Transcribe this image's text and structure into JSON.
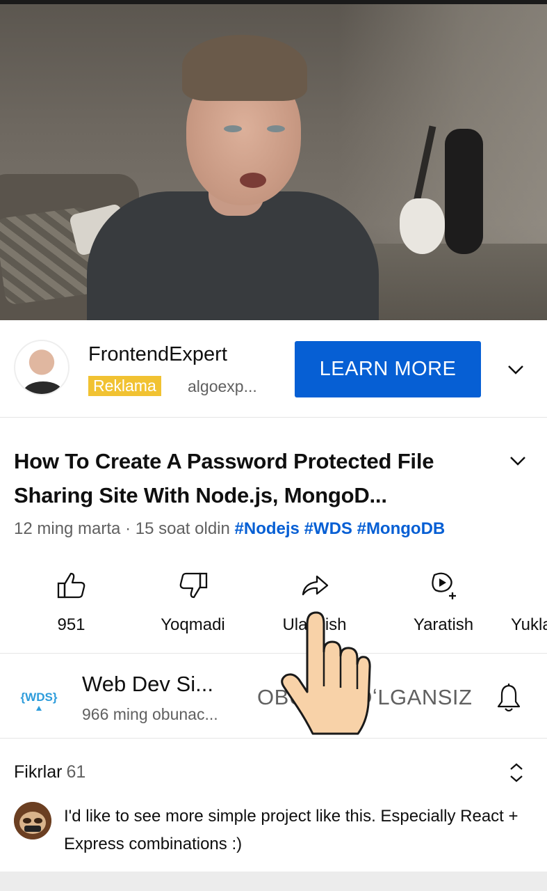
{
  "ad": {
    "advertiser": "FrontendExpert",
    "badge": "Reklama",
    "url": "algoexp...",
    "cta": "LEARN MORE"
  },
  "video": {
    "title": "How To Create A Password Protected File Sharing Site With Node.js, MongoD...",
    "views": "12 ming marta",
    "separator": "·",
    "time": "15 soat oldin",
    "hashtags": [
      "#Nodejs",
      "#WDS",
      "#MongoDB"
    ]
  },
  "actions": [
    {
      "icon": "thumbs-up-icon",
      "label": "951"
    },
    {
      "icon": "thumbs-down-icon",
      "label": "Yoqmadi"
    },
    {
      "icon": "share-icon",
      "label": "Ulashish"
    },
    {
      "icon": "create-icon",
      "label": "Yaratish"
    },
    {
      "icon": "download-icon",
      "label": "Yuklab olish"
    }
  ],
  "channel": {
    "name": "Web Dev Si...",
    "subscribers": "966 ming obunac...",
    "subscribe_state": "OBUNA BOʻLGANSIZ",
    "logo_text": "{WDS}"
  },
  "comments": {
    "title": "Fikrlar",
    "count": "61",
    "top_comment": "I'd like to see more simple project like this. Especially React + Express combinations :)"
  },
  "colors": {
    "accent": "#065fd4",
    "ad_badge": "#f1c232",
    "secondary_text": "#606060"
  }
}
